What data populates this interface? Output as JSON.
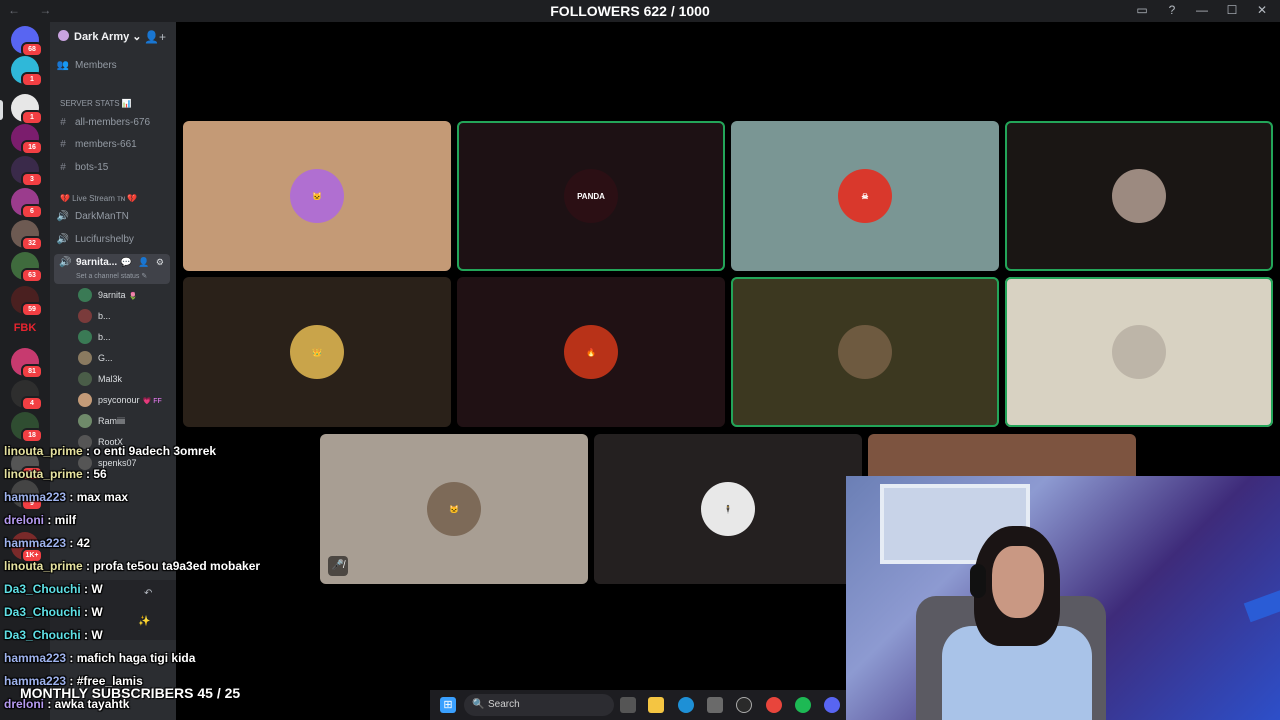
{
  "window": {
    "nav": "← →",
    "controls": [
      "▭",
      "?",
      "—",
      "☐",
      "✕"
    ]
  },
  "overlay": {
    "followers": "FOLLOWERS 622 / 1000",
    "monthly_subscribers": "MONTHLY SUBSCRIBERS 45 / 25"
  },
  "server_rail": {
    "badges": [
      "68",
      "1",
      "1",
      "16",
      "3",
      "6",
      "32",
      "63",
      "59",
      "81",
      "4",
      "18",
      "12",
      "9",
      "1K+"
    ],
    "fbk_label": "FBK"
  },
  "sidebar": {
    "guild_name": "Dark Army",
    "guild_chevron": "⌄",
    "add_member_icon": "👤+",
    "members_label": "Members",
    "server_stats_category": "SERVER STATS 📊",
    "stat_channels": [
      "all-members-676",
      "members-661",
      "bots-15"
    ],
    "live_category": "💔 Live Stream ᴛɴ 💔",
    "voice_channels": [
      "DarkManTN",
      "Lucifurshelby"
    ],
    "active_channel": {
      "name": "9arnita...",
      "status": "Set a channel status ✎",
      "tools": "💬 👤 ⚙"
    },
    "voice_users": [
      {
        "name": "9arnita",
        "tag": "🌷",
        "color": "#3a7a55"
      },
      {
        "name": "b...",
        "tag": "",
        "color": "#7a3b3b"
      },
      {
        "name": "b...",
        "tag": "",
        "color": "#3a7a55"
      },
      {
        "name": "G...",
        "tag": "",
        "color": "#8a7a60"
      },
      {
        "name": "Mal3k",
        "tag": "",
        "color": "#4a5d48"
      },
      {
        "name": "psyconour",
        "tag": "💗 FF",
        "color": "#c49b78"
      },
      {
        "name": "Ramiiii",
        "tag": "",
        "color": "#6f8a6a"
      },
      {
        "name": "RootX",
        "tag": "",
        "color": "#555"
      },
      {
        "name": "spenks07",
        "tag": "",
        "color": "#555"
      }
    ]
  },
  "tiles": [
    {
      "bg": "#c49a76",
      "avatar_bg": "#b06fd1",
      "label": "🐱",
      "speaking": false
    },
    {
      "bg": "#1d1114",
      "avatar_bg": "#2b0f14",
      "label": "PANDA",
      "speaking": true
    },
    {
      "bg": "#7a9694",
      "avatar_bg": "#d9382c",
      "label": "☠",
      "speaking": false
    },
    {
      "bg": "#1a1614",
      "avatar_bg": "#9c8a80",
      "label": "",
      "speaking": true
    },
    {
      "bg": "#2a2119",
      "avatar_bg": "#c9a44a",
      "label": "👑",
      "speaking": false
    },
    {
      "bg": "#201114",
      "avatar_bg": "#b83218",
      "label": "🔥",
      "speaking": false
    },
    {
      "bg": "#3c3820",
      "avatar_bg": "#6e5a40",
      "label": "",
      "speaking": true
    },
    {
      "bg": "#d8d2c2",
      "avatar_bg": "#bdb5a8",
      "label": "",
      "speaking": true
    },
    {
      "bg": "#a89e93",
      "avatar_bg": "#7d6a58",
      "label": "🐱",
      "speaking": false,
      "muted": true
    },
    {
      "bg": "#242020",
      "avatar_bg": "#e8e8e8",
      "label": "🕴",
      "speaking": false
    },
    {
      "bg": "#7d5440",
      "avatar_bg": "#7d5440",
      "label": "",
      "speaking": false
    }
  ],
  "mute_icon": "🎤̸",
  "chat": [
    {
      "user": "linouta_prime",
      "text": " : o enti 9adech 3omrek"
    },
    {
      "user": "linouta_prime",
      "text": " : 56"
    },
    {
      "user": "hamma223",
      "text": " : max max"
    },
    {
      "user": "dreloni",
      "text": " : milf"
    },
    {
      "user": "hamma223",
      "text": " : 42"
    },
    {
      "user": "linouta_prime",
      "text": " : profa te5ou ta9a3ed mobaker"
    },
    {
      "user": "Da3_Chouchi",
      "text": " : W"
    },
    {
      "user": "Da3_Chouchi",
      "text": " : W"
    },
    {
      "user": "Da3_Chouchi",
      "text": " : W"
    },
    {
      "user": "hamma223",
      "text": " : mafich haga tigi kida"
    },
    {
      "user": "hamma223",
      "text": " : #free_lamis"
    },
    {
      "user": "dreloni",
      "text": " : awka tayahtk"
    }
  ],
  "taskbar": {
    "search_placeholder": "Search",
    "icons": [
      "windows-icon",
      "task-view-icon",
      "file-explorer-icon",
      "edge-icon",
      "store-icon",
      "obs-icon",
      "chrome-icon",
      "spotify-icon",
      "discord-icon"
    ]
  }
}
